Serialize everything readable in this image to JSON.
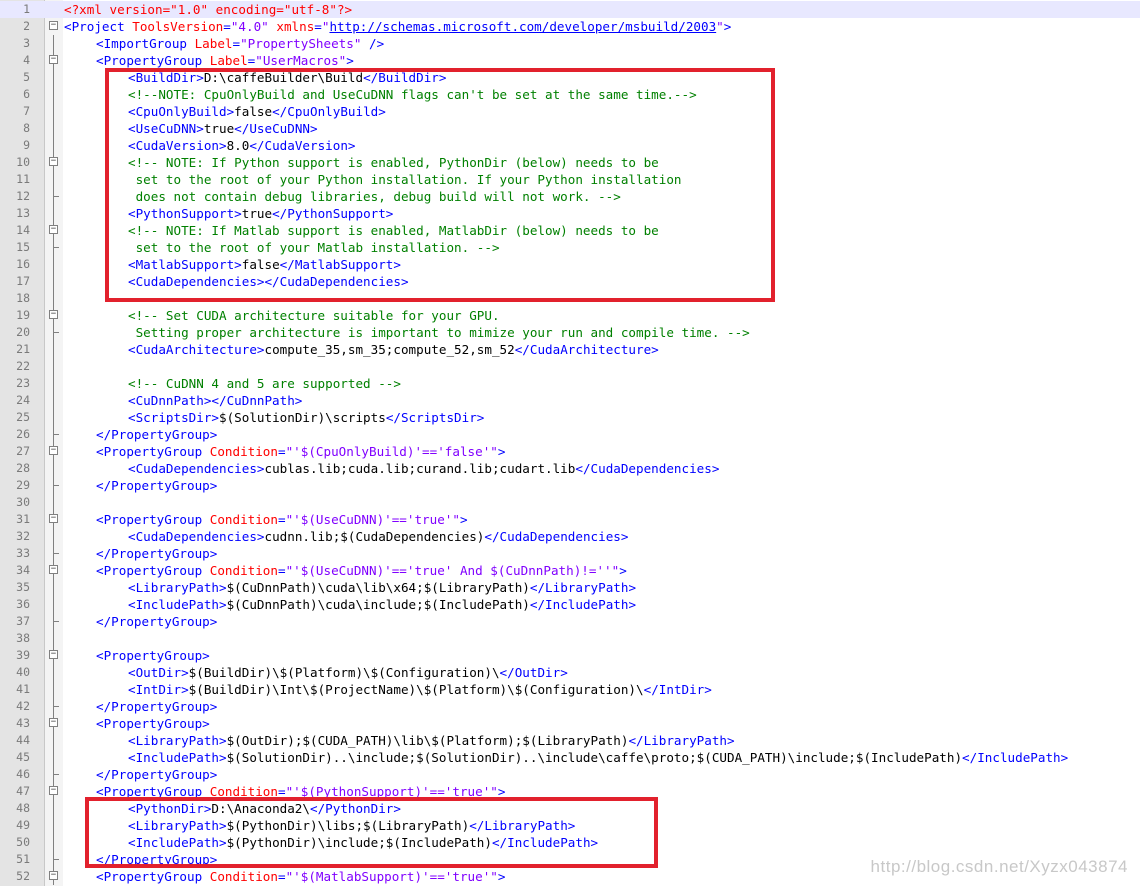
{
  "editor": {
    "lines": [
      {
        "n": "1",
        "indent": 0,
        "current": true,
        "tokens": [
          [
            "pi",
            "<?xml version=\"1.0\" encoding=\"utf-8\"?>"
          ]
        ]
      },
      {
        "n": "2",
        "indent": 0,
        "tokens": [
          [
            "tag",
            "<Project "
          ],
          [
            "attr",
            "ToolsVersion"
          ],
          [
            "tag",
            "="
          ],
          [
            "val",
            "\"4.0\""
          ],
          [
            "tag",
            " "
          ],
          [
            "attr",
            "xmlns"
          ],
          [
            "tag",
            "="
          ],
          [
            "val",
            "\""
          ],
          [
            "url",
            "http://schemas.microsoft.com/developer/msbuild/2003"
          ],
          [
            "val",
            "\""
          ],
          [
            "tag",
            ">"
          ]
        ]
      },
      {
        "n": "3",
        "indent": 1,
        "tokens": [
          [
            "tag",
            "<ImportGroup "
          ],
          [
            "attr",
            "Label"
          ],
          [
            "tag",
            "="
          ],
          [
            "val",
            "\"PropertySheets\""
          ],
          [
            "tag",
            " />"
          ]
        ]
      },
      {
        "n": "4",
        "indent": 1,
        "tokens": [
          [
            "tag",
            "<PropertyGroup "
          ],
          [
            "attr",
            "Label"
          ],
          [
            "tag",
            "="
          ],
          [
            "val",
            "\"UserMacros\""
          ],
          [
            "tag",
            ">"
          ]
        ]
      },
      {
        "n": "5",
        "indent": 2,
        "tokens": [
          [
            "tag",
            "<BuildDir>"
          ],
          [
            "txt",
            "D:\\caffeBuilder\\Build"
          ],
          [
            "tag",
            "</BuildDir>"
          ]
        ]
      },
      {
        "n": "6",
        "indent": 2,
        "tokens": [
          [
            "cmt",
            "<!--NOTE: CpuOnlyBuild and UseCuDNN flags can't be set at the same time.-->"
          ]
        ]
      },
      {
        "n": "7",
        "indent": 2,
        "tokens": [
          [
            "tag",
            "<CpuOnlyBuild>"
          ],
          [
            "txt",
            "false"
          ],
          [
            "tag",
            "</CpuOnlyBuild>"
          ]
        ]
      },
      {
        "n": "8",
        "indent": 2,
        "tokens": [
          [
            "tag",
            "<UseCuDNN>"
          ],
          [
            "txt",
            "true"
          ],
          [
            "tag",
            "</UseCuDNN>"
          ]
        ]
      },
      {
        "n": "9",
        "indent": 2,
        "tokens": [
          [
            "tag",
            "<CudaVersion>"
          ],
          [
            "txt",
            "8.0"
          ],
          [
            "tag",
            "</CudaVersion>"
          ]
        ]
      },
      {
        "n": "10",
        "indent": 2,
        "tokens": [
          [
            "cmt",
            "<!-- NOTE: If Python support is enabled, PythonDir (below) needs to be"
          ]
        ]
      },
      {
        "n": "11",
        "indent": 2,
        "tokens": [
          [
            "cmt",
            " set to the root of your Python installation. If your Python installation"
          ]
        ]
      },
      {
        "n": "12",
        "indent": 2,
        "tokens": [
          [
            "cmt",
            " does not contain debug libraries, debug build will not work. -->"
          ]
        ]
      },
      {
        "n": "13",
        "indent": 2,
        "tokens": [
          [
            "tag",
            "<PythonSupport>"
          ],
          [
            "txt",
            "true"
          ],
          [
            "tag",
            "</PythonSupport>"
          ]
        ]
      },
      {
        "n": "14",
        "indent": 2,
        "tokens": [
          [
            "cmt",
            "<!-- NOTE: If Matlab support is enabled, MatlabDir (below) needs to be"
          ]
        ]
      },
      {
        "n": "15",
        "indent": 2,
        "tokens": [
          [
            "cmt",
            " set to the root of your Matlab installation. -->"
          ]
        ]
      },
      {
        "n": "16",
        "indent": 2,
        "tokens": [
          [
            "tag",
            "<MatlabSupport>"
          ],
          [
            "txt",
            "false"
          ],
          [
            "tag",
            "</MatlabSupport>"
          ]
        ]
      },
      {
        "n": "17",
        "indent": 2,
        "tokens": [
          [
            "tag",
            "<CudaDependencies></CudaDependencies>"
          ]
        ]
      },
      {
        "n": "18",
        "indent": 0,
        "tokens": []
      },
      {
        "n": "19",
        "indent": 2,
        "tokens": [
          [
            "cmt",
            "<!-- Set CUDA architecture suitable for your GPU."
          ]
        ]
      },
      {
        "n": "20",
        "indent": 2,
        "tokens": [
          [
            "cmt",
            " Setting proper architecture is important to mimize your run and compile time. -->"
          ]
        ]
      },
      {
        "n": "21",
        "indent": 2,
        "tokens": [
          [
            "tag",
            "<CudaArchitecture>"
          ],
          [
            "txt",
            "compute_35,sm_35;compute_52,sm_52"
          ],
          [
            "tag",
            "</CudaArchitecture>"
          ]
        ]
      },
      {
        "n": "22",
        "indent": 0,
        "tokens": []
      },
      {
        "n": "23",
        "indent": 2,
        "tokens": [
          [
            "cmt",
            "<!-- CuDNN 4 and 5 are supported -->"
          ]
        ]
      },
      {
        "n": "24",
        "indent": 2,
        "tokens": [
          [
            "tag",
            "<CuDnnPath></CuDnnPath>"
          ]
        ]
      },
      {
        "n": "25",
        "indent": 2,
        "tokens": [
          [
            "tag",
            "<ScriptsDir>"
          ],
          [
            "txt",
            "$(SolutionDir)\\scripts"
          ],
          [
            "tag",
            "</ScriptsDir>"
          ]
        ]
      },
      {
        "n": "26",
        "indent": 1,
        "tokens": [
          [
            "tag",
            "</PropertyGroup>"
          ]
        ]
      },
      {
        "n": "27",
        "indent": 1,
        "tokens": [
          [
            "tag",
            "<PropertyGroup "
          ],
          [
            "attr",
            "Condition"
          ],
          [
            "tag",
            "="
          ],
          [
            "val",
            "\"'$(CpuOnlyBuild)'=='false'\""
          ],
          [
            "tag",
            ">"
          ]
        ]
      },
      {
        "n": "28",
        "indent": 2,
        "tokens": [
          [
            "tag",
            "<CudaDependencies>"
          ],
          [
            "txt",
            "cublas.lib;cuda.lib;curand.lib;cudart.lib"
          ],
          [
            "tag",
            "</CudaDependencies>"
          ]
        ]
      },
      {
        "n": "29",
        "indent": 1,
        "tokens": [
          [
            "tag",
            "</PropertyGroup>"
          ]
        ]
      },
      {
        "n": "30",
        "indent": 0,
        "tokens": []
      },
      {
        "n": "31",
        "indent": 1,
        "tokens": [
          [
            "tag",
            "<PropertyGroup "
          ],
          [
            "attr",
            "Condition"
          ],
          [
            "tag",
            "="
          ],
          [
            "val",
            "\"'$(UseCuDNN)'=='true'\""
          ],
          [
            "tag",
            ">"
          ]
        ]
      },
      {
        "n": "32",
        "indent": 2,
        "tokens": [
          [
            "tag",
            "<CudaDependencies>"
          ],
          [
            "txt",
            "cudnn.lib;$(CudaDependencies)"
          ],
          [
            "tag",
            "</CudaDependencies>"
          ]
        ]
      },
      {
        "n": "33",
        "indent": 1,
        "tokens": [
          [
            "tag",
            "</PropertyGroup>"
          ]
        ]
      },
      {
        "n": "34",
        "indent": 1,
        "tokens": [
          [
            "tag",
            "<PropertyGroup "
          ],
          [
            "attr",
            "Condition"
          ],
          [
            "tag",
            "="
          ],
          [
            "val",
            "\"'$(UseCuDNN)'=='true' And $(CuDnnPath)!=''\""
          ],
          [
            "tag",
            ">"
          ]
        ]
      },
      {
        "n": "35",
        "indent": 2,
        "tokens": [
          [
            "tag",
            "<LibraryPath>"
          ],
          [
            "txt",
            "$(CuDnnPath)\\cuda\\lib\\x64;$(LibraryPath)"
          ],
          [
            "tag",
            "</LibraryPath>"
          ]
        ]
      },
      {
        "n": "36",
        "indent": 2,
        "tokens": [
          [
            "tag",
            "<IncludePath>"
          ],
          [
            "txt",
            "$(CuDnnPath)\\cuda\\include;$(IncludePath)"
          ],
          [
            "tag",
            "</IncludePath>"
          ]
        ]
      },
      {
        "n": "37",
        "indent": 1,
        "tokens": [
          [
            "tag",
            "</PropertyGroup>"
          ]
        ]
      },
      {
        "n": "38",
        "indent": 0,
        "tokens": []
      },
      {
        "n": "39",
        "indent": 1,
        "tokens": [
          [
            "tag",
            "<PropertyGroup>"
          ]
        ]
      },
      {
        "n": "40",
        "indent": 2,
        "tokens": [
          [
            "tag",
            "<OutDir>"
          ],
          [
            "txt",
            "$(BuildDir)\\$(Platform)\\$(Configuration)\\"
          ],
          [
            "tag",
            "</OutDir>"
          ]
        ]
      },
      {
        "n": "41",
        "indent": 2,
        "tokens": [
          [
            "tag",
            "<IntDir>"
          ],
          [
            "txt",
            "$(BuildDir)\\Int\\$(ProjectName)\\$(Platform)\\$(Configuration)\\"
          ],
          [
            "tag",
            "</IntDir>"
          ]
        ]
      },
      {
        "n": "42",
        "indent": 1,
        "tokens": [
          [
            "tag",
            "</PropertyGroup>"
          ]
        ]
      },
      {
        "n": "43",
        "indent": 1,
        "tokens": [
          [
            "tag",
            "<PropertyGroup>"
          ]
        ]
      },
      {
        "n": "44",
        "indent": 2,
        "tokens": [
          [
            "tag",
            "<LibraryPath>"
          ],
          [
            "txt",
            "$(OutDir);$(CUDA_PATH)\\lib\\$(Platform);$(LibraryPath)"
          ],
          [
            "tag",
            "</LibraryPath>"
          ]
        ]
      },
      {
        "n": "45",
        "indent": 2,
        "tokens": [
          [
            "tag",
            "<IncludePath>"
          ],
          [
            "txt",
            "$(SolutionDir)..\\include;$(SolutionDir)..\\include\\caffe\\proto;$(CUDA_PATH)\\include;$(IncludePath)"
          ],
          [
            "tag",
            "</IncludePath>"
          ]
        ]
      },
      {
        "n": "46",
        "indent": 1,
        "tokens": [
          [
            "tag",
            "</PropertyGroup>"
          ]
        ]
      },
      {
        "n": "47",
        "indent": 1,
        "tokens": [
          [
            "tag",
            "<PropertyGroup "
          ],
          [
            "attr",
            "Condition"
          ],
          [
            "tag",
            "="
          ],
          [
            "val",
            "\"'$(PythonSupport)'=='true'\""
          ],
          [
            "tag",
            ">"
          ]
        ]
      },
      {
        "n": "48",
        "indent": 2,
        "tokens": [
          [
            "tag",
            "<PythonDir>"
          ],
          [
            "txt",
            "D:\\Anaconda2\\"
          ],
          [
            "tag",
            "</PythonDir>"
          ]
        ]
      },
      {
        "n": "49",
        "indent": 2,
        "tokens": [
          [
            "tag",
            "<LibraryPath>"
          ],
          [
            "txt",
            "$(PythonDir)\\libs;$(LibraryPath)"
          ],
          [
            "tag",
            "</LibraryPath>"
          ]
        ]
      },
      {
        "n": "50",
        "indent": 2,
        "tokens": [
          [
            "tag",
            "<IncludePath>"
          ],
          [
            "txt",
            "$(PythonDir)\\include;$(IncludePath)"
          ],
          [
            "tag",
            "</IncludePath>"
          ]
        ]
      },
      {
        "n": "51",
        "indent": 1,
        "tokens": [
          [
            "tag",
            "</PropertyGroup>"
          ]
        ]
      },
      {
        "n": "52",
        "indent": 1,
        "tokens": [
          [
            "tag",
            "<PropertyGroup "
          ],
          [
            "attr",
            "Condition"
          ],
          [
            "tag",
            "="
          ],
          [
            "val",
            "\"'$(MatlabSupport)'=='true'\""
          ],
          [
            "tag",
            ">"
          ]
        ]
      }
    ],
    "folds": {
      "2": "box",
      "4": "box",
      "10": "box",
      "14": "box",
      "19": "box",
      "27": "box",
      "31": "box",
      "34": "box",
      "39": "box",
      "43": "box",
      "47": "box",
      "52": "box",
      "11": "line",
      "12": "end",
      "15": "end",
      "20": "end",
      "3": "line",
      "5": "line",
      "6": "line",
      "7": "line",
      "8": "line",
      "9": "line",
      "13": "line",
      "16": "line",
      "17": "line",
      "18": "line",
      "21": "line",
      "22": "line",
      "23": "line",
      "24": "line",
      "25": "line",
      "26": "end",
      "28": "line",
      "29": "end",
      "30": "line",
      "32": "line",
      "33": "end",
      "35": "line",
      "36": "line",
      "37": "end",
      "38": "line",
      "40": "line",
      "41": "line",
      "42": "end",
      "44": "line",
      "45": "line",
      "46": "end",
      "48": "line",
      "49": "line",
      "50": "line",
      "51": "end"
    }
  },
  "colors": {
    "tag": "#0000ff",
    "attribute": "#ff0000",
    "value": "#8000ff",
    "comment": "#008000",
    "text": "#000000",
    "highlight_box": "#e2212d"
  },
  "watermark": "http://blog.csdn.net/Xyzx043874"
}
